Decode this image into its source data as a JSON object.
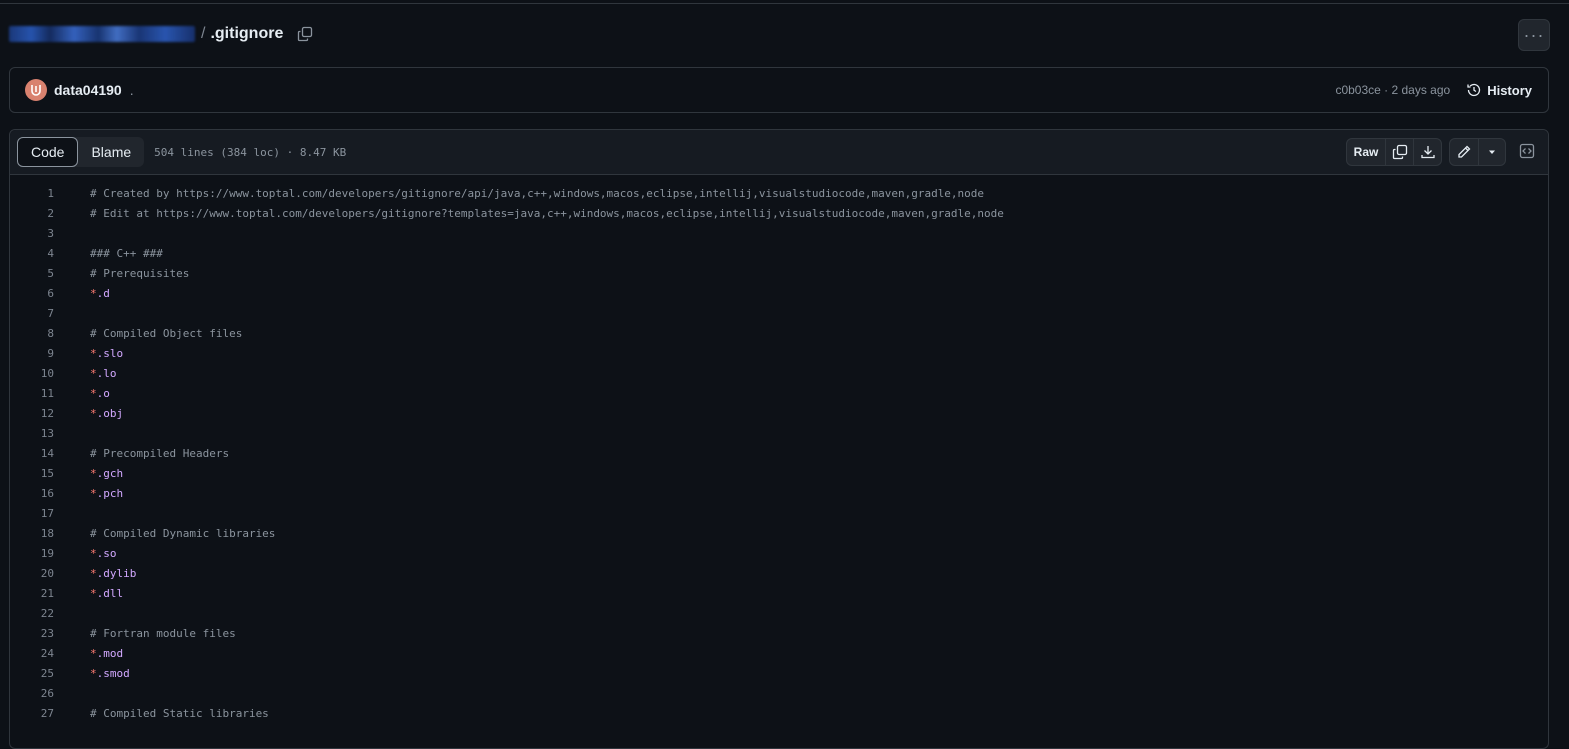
{
  "header": {
    "path_separator": "/",
    "file_name": ".gitignore",
    "more_label": "···"
  },
  "commit": {
    "author": "data04190",
    "message": ".",
    "meta": "c0b03ce · 2 days ago",
    "history_label": "History"
  },
  "file": {
    "tabs": {
      "code": "Code",
      "blame": "Blame"
    },
    "info": "504 lines (384 loc) · 8.47 KB",
    "raw_label": "Raw"
  },
  "lines": [
    {
      "num": "1",
      "text": "# Created by https://www.toptal.com/developers/gitignore/api/java,c++,windows,macos,eclipse,intellij,visualstudiocode,maven,gradle,node",
      "star": "",
      "pat": ""
    },
    {
      "num": "2",
      "text": "# Edit at https://www.toptal.com/developers/gitignore?templates=java,c++,windows,macos,eclipse,intellij,visualstudiocode,maven,gradle,node",
      "star": "",
      "pat": ""
    },
    {
      "num": "3",
      "text": "",
      "star": "",
      "pat": ""
    },
    {
      "num": "4",
      "text": "### C++ ###",
      "star": "",
      "pat": ""
    },
    {
      "num": "5",
      "text": "# Prerequisites",
      "star": "",
      "pat": ""
    },
    {
      "num": "6",
      "text": "",
      "star": "*",
      "pat": ".d"
    },
    {
      "num": "7",
      "text": "",
      "star": "",
      "pat": ""
    },
    {
      "num": "8",
      "text": "# Compiled Object files",
      "star": "",
      "pat": ""
    },
    {
      "num": "9",
      "text": "",
      "star": "*",
      "pat": ".slo"
    },
    {
      "num": "10",
      "text": "",
      "star": "*",
      "pat": ".lo"
    },
    {
      "num": "11",
      "text": "",
      "star": "*",
      "pat": ".o"
    },
    {
      "num": "12",
      "text": "",
      "star": "*",
      "pat": ".obj"
    },
    {
      "num": "13",
      "text": "",
      "star": "",
      "pat": ""
    },
    {
      "num": "14",
      "text": "# Precompiled Headers",
      "star": "",
      "pat": ""
    },
    {
      "num": "15",
      "text": "",
      "star": "*",
      "pat": ".gch"
    },
    {
      "num": "16",
      "text": "",
      "star": "*",
      "pat": ".pch"
    },
    {
      "num": "17",
      "text": "",
      "star": "",
      "pat": ""
    },
    {
      "num": "18",
      "text": "# Compiled Dynamic libraries",
      "star": "",
      "pat": ""
    },
    {
      "num": "19",
      "text": "",
      "star": "*",
      "pat": ".so"
    },
    {
      "num": "20",
      "text": "",
      "star": "*",
      "pat": ".dylib"
    },
    {
      "num": "21",
      "text": "",
      "star": "*",
      "pat": ".dll"
    },
    {
      "num": "22",
      "text": "",
      "star": "",
      "pat": ""
    },
    {
      "num": "23",
      "text": "# Fortran module files",
      "star": "",
      "pat": ""
    },
    {
      "num": "24",
      "text": "",
      "star": "*",
      "pat": ".mod"
    },
    {
      "num": "25",
      "text": "",
      "star": "*",
      "pat": ".smod"
    },
    {
      "num": "26",
      "text": "",
      "star": "",
      "pat": ""
    },
    {
      "num": "27",
      "text": "# Compiled Static libraries",
      "star": "",
      "pat": ""
    }
  ]
}
